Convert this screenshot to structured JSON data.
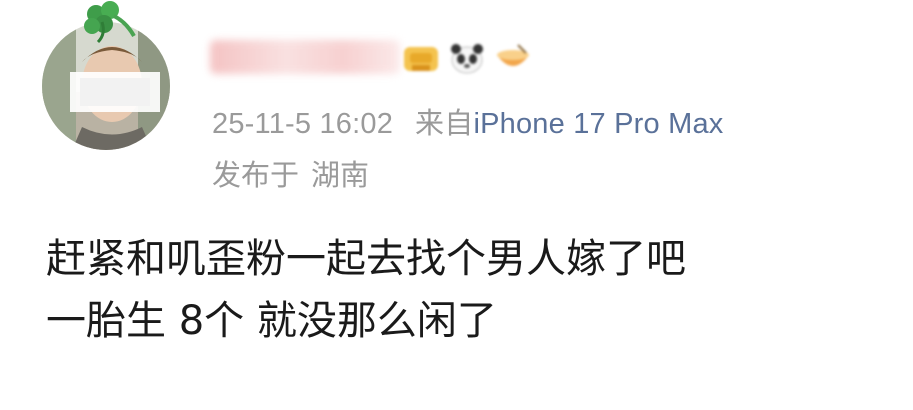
{
  "post": {
    "avatar": {
      "icon": "avatar-with-clover-hat"
    },
    "username": {
      "badges": [
        "gold-trophy-icon",
        "panda-face-icon",
        "bowl-icon"
      ]
    },
    "meta": {
      "timestamp": "25-11-5 16:02",
      "source_prefix": "来自",
      "device": "iPhone 17 Pro Max"
    },
    "location": {
      "prefix": "发布于",
      "place": "湖南"
    },
    "content": {
      "lines": [
        "赶紧和叽歪粉一起去找个男人嫁了吧",
        "一胎生 8个 就没那么闲了"
      ]
    },
    "colors": {
      "meta_gray": "#9a9a9a",
      "device_blue": "#5a7199",
      "text": "#1a1a1a"
    }
  }
}
